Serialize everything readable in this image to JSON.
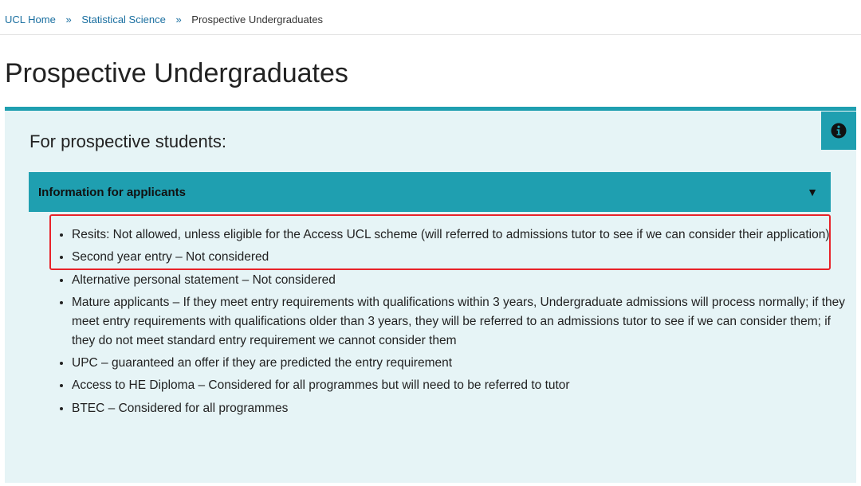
{
  "breadcrumb": {
    "home": "UCL Home",
    "section": "Statistical Science",
    "current": "Prospective Undergraduates",
    "separator": "»"
  },
  "page": {
    "title": "Prospective Undergraduates"
  },
  "panel": {
    "heading": "For prospective students:",
    "info_icon": "info-circle-icon",
    "accent_color": "#1f9fb0",
    "background_color": "#e6f4f6"
  },
  "accordion": {
    "title": "Information for applicants",
    "state_icon": "triangle-down-icon",
    "arrow": "▼",
    "expanded": true
  },
  "items": [
    "Resits: Not allowed, unless eligible for the Access UCL scheme (will referred to admissions tutor to see if we can consider their application)",
    "Second year entry – Not considered",
    "Alternative personal statement – Not considered",
    "Mature applicants – If they meet entry requirements with qualifications within 3 years, Undergraduate admissions will process normally; if they meet entry requirements with qualifications older than 3 years, they will be referred to an admissions tutor to see if we can consider them; if they do not meet standard entry requirement we cannot consider them",
    "UPC – guaranteed an offer if they are predicted the entry requirement",
    "Access to HE Diploma – Considered for all programmes but will need to be referred to tutor",
    "BTEC – Considered for all programmes"
  ],
  "highlight": {
    "color": "#e8232a",
    "target_item": 0
  }
}
